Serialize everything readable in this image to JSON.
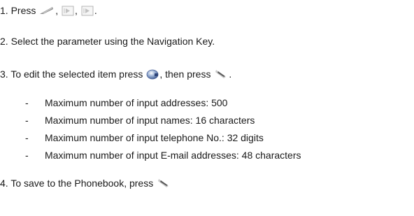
{
  "steps": [
    {
      "prefix": "1. Press",
      "sep1": ",",
      "sep2": ",",
      "suffix": ".",
      "icons": [
        "left-soft-key-icon",
        "menu-key-icon",
        "menu-key-icon"
      ]
    },
    {
      "text": "2. Select the parameter using the Navigation Key."
    },
    {
      "prefix": "3. To edit the selected item press",
      "middle": ", then press",
      "suffix": ".",
      "icons": [
        "confirm-key-icon",
        "right-soft-key-icon"
      ]
    },
    {
      "prefix": "4.  To save to the Phonebook, press",
      "icons": [
        "right-soft-key-icon"
      ]
    }
  ],
  "limits": [
    {
      "dash": "-",
      "text": "Maximum number of input addresses: 500"
    },
    {
      "dash": "-",
      "text": "Maximum number of input names: 16 characters"
    },
    {
      "dash": "-",
      "text": "Maximum number of input telephone No.: 32 digits"
    },
    {
      "dash": "-",
      "text": "Maximum number of input E-mail addresses: 48 characters"
    }
  ]
}
